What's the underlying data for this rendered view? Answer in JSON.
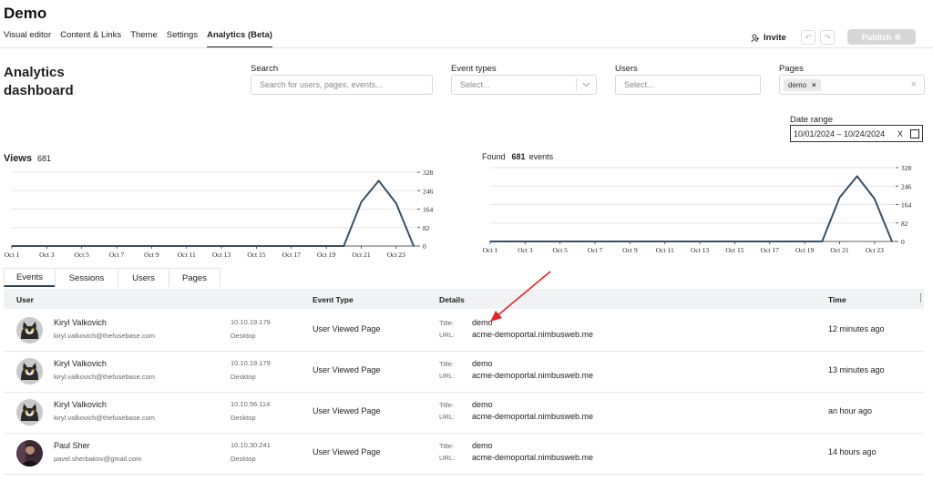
{
  "app": {
    "title": "Demo"
  },
  "nav": {
    "tabs": [
      {
        "label": "Visual editor"
      },
      {
        "label": "Content & Links"
      },
      {
        "label": "Theme"
      },
      {
        "label": "Settings"
      },
      {
        "label": "Analytics (Beta)"
      }
    ],
    "invite_label": "Invite",
    "publish_label": "Publish"
  },
  "dashboard": {
    "title": "Analytics dashboard"
  },
  "filters": {
    "search": {
      "label": "Search",
      "placeholder": "Search for users, pages, events..."
    },
    "event_types": {
      "label": "Event types",
      "placeholder": "Select..."
    },
    "users": {
      "label": "Users",
      "placeholder": "Select..."
    },
    "pages": {
      "label": "Pages",
      "chip": "demo",
      "chip_remove": "×",
      "clear": "×"
    },
    "date_range": {
      "label": "Date range",
      "value": "10/01/2024 – 10/24/2024",
      "clear": "X"
    }
  },
  "views_chart": {
    "title": "Views",
    "count": "681"
  },
  "events_chart": {
    "prefix": "Found",
    "count": "681",
    "suffix": "events"
  },
  "chart_data": [
    {
      "type": "line",
      "x": [
        "Oct 1",
        "Oct 2",
        "Oct 3",
        "Oct 4",
        "Oct 5",
        "Oct 6",
        "Oct 7",
        "Oct 8",
        "Oct 9",
        "Oct 10",
        "Oct 11",
        "Oct 12",
        "Oct 13",
        "Oct 14",
        "Oct 15",
        "Oct 16",
        "Oct 17",
        "Oct 18",
        "Oct 19",
        "Oct 20",
        "Oct 21",
        "Oct 22",
        "Oct 23",
        "Oct 24"
      ],
      "tick_labels": [
        "Oct 1",
        "Oct 3",
        "Oct 5",
        "Oct 7",
        "Oct 9",
        "Oct 11",
        "Oct 13",
        "Oct 15",
        "Oct 17",
        "Oct 19",
        "Oct 21",
        "Oct 23"
      ],
      "values": [
        0,
        0,
        0,
        0,
        0,
        0,
        0,
        0,
        0,
        0,
        0,
        0,
        0,
        0,
        0,
        0,
        0,
        0,
        0,
        0,
        195,
        290,
        190,
        0
      ],
      "yticks": [
        0,
        82,
        164,
        246,
        328
      ],
      "ylim": [
        0,
        328
      ],
      "grid": true,
      "color": "#3d4e63"
    },
    {
      "type": "line",
      "x": [
        "Oct 1",
        "Oct 2",
        "Oct 3",
        "Oct 4",
        "Oct 5",
        "Oct 6",
        "Oct 7",
        "Oct 8",
        "Oct 9",
        "Oct 10",
        "Oct 11",
        "Oct 12",
        "Oct 13",
        "Oct 14",
        "Oct 15",
        "Oct 16",
        "Oct 17",
        "Oct 18",
        "Oct 19",
        "Oct 20",
        "Oct 21",
        "Oct 22",
        "Oct 23",
        "Oct 24"
      ],
      "tick_labels": [
        "Oct 1",
        "Oct 3",
        "Oct 5",
        "Oct 7",
        "Oct 9",
        "Oct 11",
        "Oct 13",
        "Oct 15",
        "Oct 17",
        "Oct 19",
        "Oct 21",
        "Oct 23"
      ],
      "values": [
        0,
        0,
        0,
        0,
        0,
        0,
        0,
        0,
        0,
        0,
        0,
        0,
        0,
        0,
        0,
        0,
        0,
        0,
        0,
        0,
        195,
        290,
        190,
        0
      ],
      "yticks": [
        0,
        82,
        164,
        246,
        328
      ],
      "ylim": [
        0,
        328
      ],
      "grid": true,
      "color": "#3d4e63"
    }
  ],
  "tabs": [
    {
      "label": "Events"
    },
    {
      "label": "Sessions"
    },
    {
      "label": "Users"
    },
    {
      "label": "Pages"
    }
  ],
  "table": {
    "headers": {
      "user": "User",
      "event_type": "Event Type",
      "details": "Details",
      "time": "Time"
    },
    "title_label": "Title:",
    "url_label": "URL:",
    "rows": [
      {
        "name": "Kiryl Valkovich",
        "email": "kiryl.valkovich@thefusebase.com",
        "ip": "10.10.19.179",
        "device": "Desktop",
        "event_type": "User Viewed Page",
        "title": "demo",
        "url": "acme-demoportal.nimbusweb.me",
        "time": "12 minutes ago",
        "avatar": "cat-icon"
      },
      {
        "name": "Kiryl Valkovich",
        "email": "kiryl.valkovich@thefusebase.com",
        "ip": "10.10.19.179",
        "device": "Desktop",
        "event_type": "User Viewed Page",
        "title": "demo",
        "url": "acme-demoportal.nimbusweb.me",
        "time": "13 minutes ago",
        "avatar": "cat-icon"
      },
      {
        "name": "Kiryl Valkovich",
        "email": "kiryl.valkovich@thefusebase.com",
        "ip": "10.10.56.114",
        "device": "Desktop",
        "event_type": "User Viewed Page",
        "title": "demo",
        "url": "acme-demoportal.nimbusweb.me",
        "time": "an hour ago",
        "avatar": "cat-icon"
      },
      {
        "name": "Paul Sher",
        "email": "pavel.sherbakov@gmail.com",
        "ip": "10.10.30.241",
        "device": "Desktop",
        "event_type": "User Viewed Page",
        "title": "demo",
        "url": "acme-demoportal.nimbusweb.me",
        "time": "14 hours ago",
        "avatar": "person-icon"
      }
    ]
  },
  "annotation": {
    "color": "#e0262b"
  }
}
